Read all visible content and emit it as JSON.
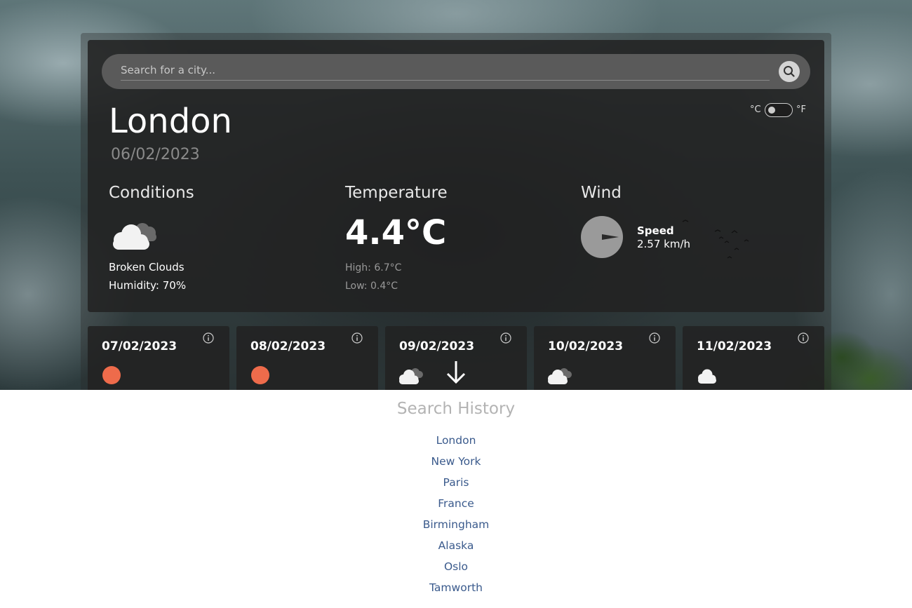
{
  "search": {
    "placeholder": "Search for a city..."
  },
  "units": {
    "celsius": "°C",
    "fahrenheit": "°F"
  },
  "current": {
    "city": "London",
    "date": "06/02/2023",
    "conditions": {
      "title": "Conditions",
      "icon": "broken-clouds-icon",
      "description": "Broken Clouds",
      "humidity": "Humidity: 70%"
    },
    "temperature": {
      "title": "Temperature",
      "value": "4.4°C",
      "high": "High: 6.7°C",
      "low": "Low: 0.4°C"
    },
    "wind": {
      "title": "Wind",
      "speed_label": "Speed",
      "speed_value": "2.57 km/h"
    }
  },
  "forecast": [
    {
      "date": "07/02/2023",
      "icon": "sun-icon"
    },
    {
      "date": "08/02/2023",
      "icon": "sun-icon"
    },
    {
      "date": "09/02/2023",
      "icon": "broken-clouds-icon"
    },
    {
      "date": "10/02/2023",
      "icon": "broken-clouds-icon"
    },
    {
      "date": "11/02/2023",
      "icon": "cloud-icon"
    }
  ],
  "history": {
    "title": "Search History",
    "items": [
      "London",
      "New York",
      "Paris",
      "France",
      "Birmingham",
      "Alaska",
      "Oslo",
      "Tamworth"
    ]
  },
  "colors": {
    "sun": "#ee6b4b",
    "link": "#3a5a8c",
    "panel": "#222222"
  }
}
